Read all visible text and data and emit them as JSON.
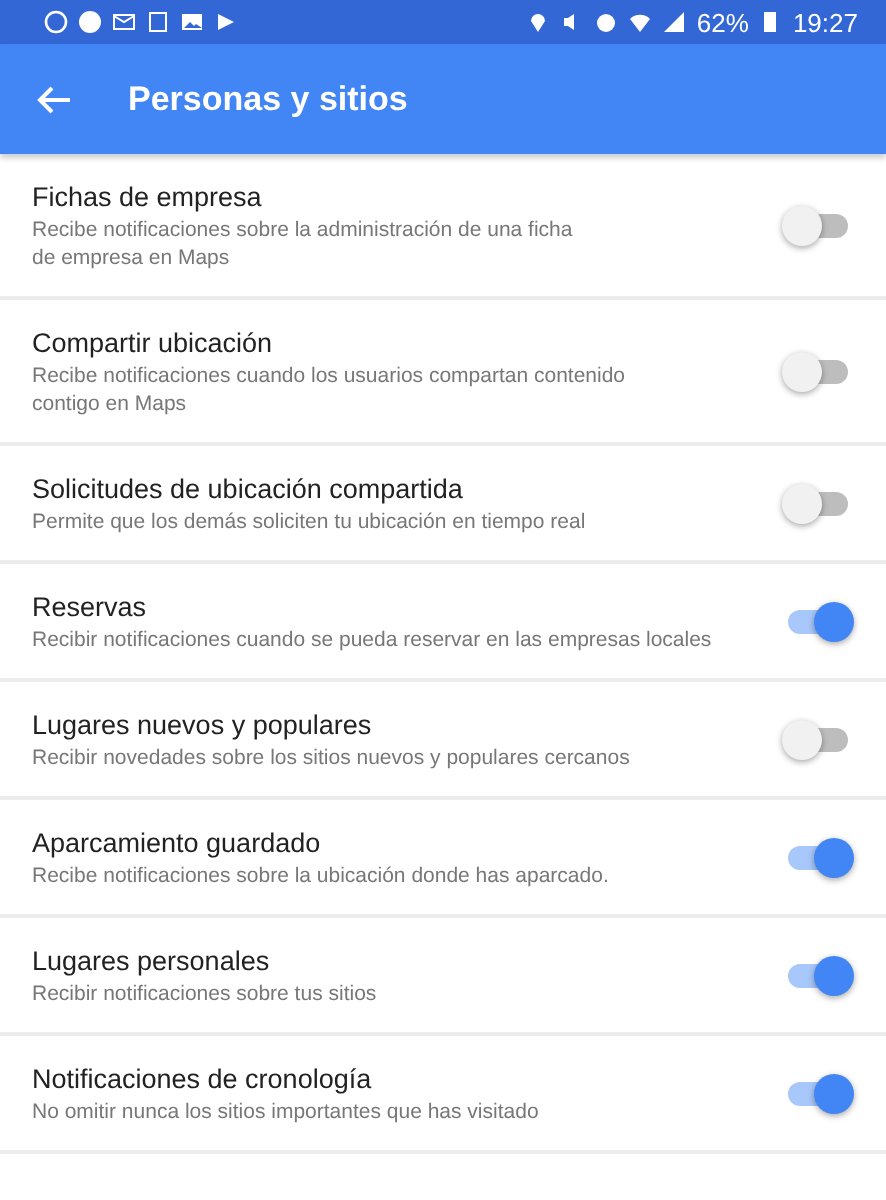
{
  "status_bar": {
    "battery": "62%",
    "time": "19:27"
  },
  "app_bar": {
    "title": "Personas y sitios"
  },
  "settings": [
    {
      "title": "Fichas de empresa",
      "description": [
        "Recibe notificaciones sobre la administración de una ficha",
        "de empresa en Maps"
      ],
      "on": false
    },
    {
      "title": "Compartir ubicación",
      "description": [
        "Recibe notificaciones cuando los usuarios compartan contenido",
        "contigo en Maps"
      ],
      "on": false
    },
    {
      "title": "Solicitudes de ubicación compartida",
      "description": [
        "Permite que los demás soliciten tu ubicación en tiempo real"
      ],
      "on": false
    },
    {
      "title": "Reservas",
      "description": [
        "Recibir notificaciones cuando se pueda reservar en las empresas locales"
      ],
      "on": true
    },
    {
      "title": "Lugares nuevos y populares",
      "description": [
        "Recibir novedades sobre los sitios nuevos y populares cercanos"
      ],
      "on": false
    },
    {
      "title": "Aparcamiento guardado",
      "description": [
        "Recibe notificaciones sobre la ubicación donde has aparcado."
      ],
      "on": true
    },
    {
      "title": "Lugares personales",
      "description": [
        "Recibir notificaciones sobre tus sitios"
      ],
      "on": true
    },
    {
      "title": "Notificaciones de cronología",
      "description": [
        "No omitir nunca los sitios importantes que has visitado"
      ],
      "on": true
    }
  ]
}
